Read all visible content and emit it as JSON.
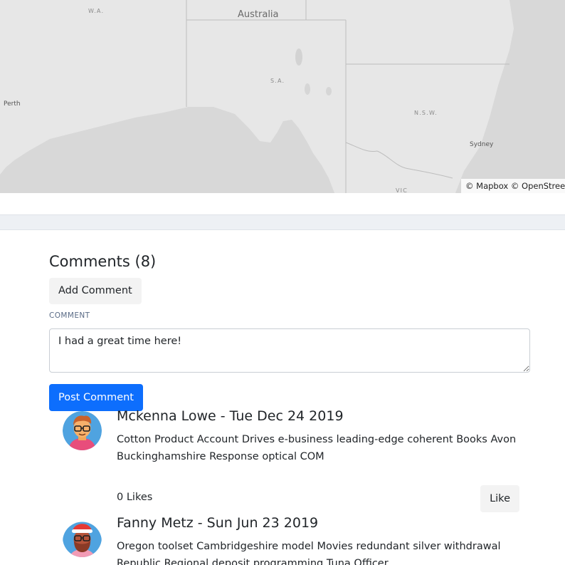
{
  "map": {
    "country_label": "Australia",
    "states": {
      "wa": "W.A.",
      "sa": "S.A.",
      "nsw": "N.S.W.",
      "vic": "VIC"
    },
    "cities": {
      "perth": "Perth",
      "sydney": "Sydney"
    },
    "attribution": "© Mapbox © OpenStreetMap",
    "colors": {
      "land": "#e6e6e6",
      "sea": "#d7d7d7",
      "border": "#bdbdbd"
    }
  },
  "comments": {
    "title": "Comments (8)",
    "add_button": "Add Comment",
    "field_label": "COMMENT",
    "textarea_value": "I had a great time here!",
    "post_button": "Post Comment",
    "items": [
      {
        "header": "Mckenna Lowe - Tue Dec 24 2019",
        "text": "Cotton Product Account Drives e-business leading-edge coherent Books Avon Buckinghamshire Response optical COM",
        "likes": "0 Likes",
        "like_button": "Like",
        "avatar": "avatar-glasses-icon"
      },
      {
        "header": "Fanny Metz - Sun Jun 23 2019",
        "text": "Oregon toolset Cambridgeshire model Movies redundant silver withdrawal Republic Regional deposit programming Tuna Officer",
        "avatar": "avatar-santa-hat-icon"
      }
    ],
    "colors": {
      "primary": "#0d6efd",
      "muted_label": "#5a6b86",
      "secondary_bg": "#f3f3f3"
    }
  }
}
